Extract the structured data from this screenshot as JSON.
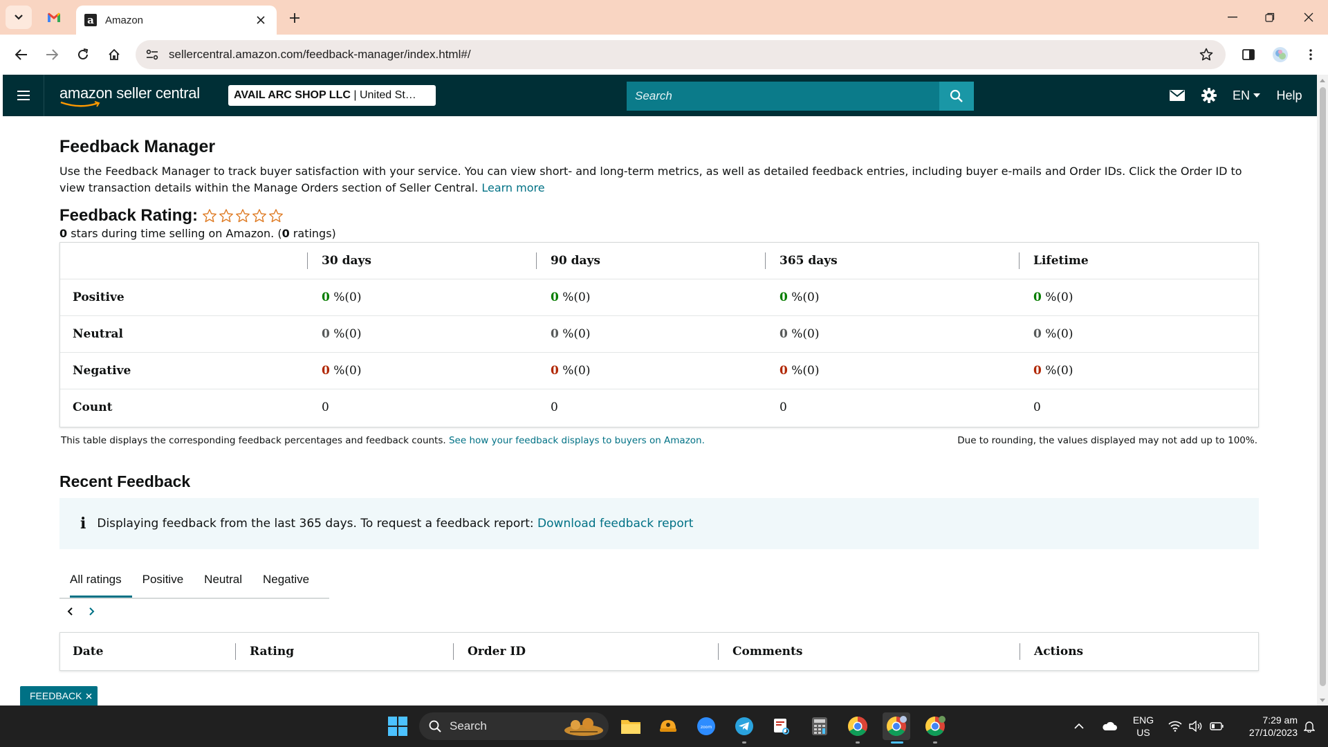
{
  "browser": {
    "tab_title": "Amazon",
    "url": "sellercentral.amazon.com/feedback-manager/index.html#/"
  },
  "header": {
    "logo": "amazon seller central",
    "account": "AVAIL ARC SHOP LLC",
    "account_suffix": " | United St…",
    "search_placeholder": "Search",
    "language": "EN",
    "help": "Help"
  },
  "page": {
    "title": "Feedback Manager",
    "intro": "Use the Feedback Manager to track buyer satisfaction with your service. You can view short- and long-term metrics, as well as detailed feedback entries, including buyer e-mails and Order IDs. Click the Order ID to view transaction details within the Manage Orders section of Seller Central.",
    "learn_more": "Learn more",
    "rating_label": "Feedback Rating:",
    "rating_stars": 0,
    "rating_value": "0",
    "rating_text_1": " stars during time selling on Amazon. (",
    "rating_count": "0",
    "rating_text_2": " ratings)"
  },
  "metrics": {
    "columns": [
      "30 days",
      "90 days",
      "365 days",
      "Lifetime"
    ],
    "rows": [
      {
        "label": "Positive",
        "cells": [
          [
            "0",
            " %(0)"
          ],
          [
            "0",
            " %(0)"
          ],
          [
            "0",
            " %(0)"
          ],
          [
            "0",
            " %(0)"
          ]
        ]
      },
      {
        "label": "Neutral",
        "cells": [
          [
            "0",
            " %(0)"
          ],
          [
            "0",
            " %(0)"
          ],
          [
            "0",
            " %(0)"
          ],
          [
            "0",
            " %(0)"
          ]
        ]
      },
      {
        "label": "Negative",
        "cells": [
          [
            "0",
            " %(0)"
          ],
          [
            "0",
            " %(0)"
          ],
          [
            "0",
            " %(0)"
          ],
          [
            "0",
            " %(0)"
          ]
        ]
      },
      {
        "label": "Count",
        "cells": [
          "0",
          "0",
          "0",
          "0"
        ]
      }
    ],
    "note": "This table displays the corresponding feedback percentages and feedback counts.",
    "note_link": "See how your feedback displays to buyers on Amazon.",
    "rounding_note": "Due to rounding, the values displayed may not add up to 100%."
  },
  "recent": {
    "title": "Recent Feedback",
    "info": "Displaying feedback from the last 365 days. To request a feedback report:",
    "info_link": "Download feedback report",
    "tabs": [
      "All ratings",
      "Positive",
      "Neutral",
      "Negative"
    ],
    "active_tab": "All ratings",
    "columns": [
      "Date",
      "Rating",
      "Order ID",
      "Comments",
      "Actions"
    ]
  },
  "feedback_button": "FEEDBACK",
  "taskbar": {
    "search": "Search",
    "lang_1": "ENG",
    "lang_2": "US",
    "time": "7:29 am",
    "date": "27/10/2023"
  },
  "colors": {
    "header_bg": "#002f36",
    "search_bg": "#0b7b8a",
    "link": "#007185",
    "positive": "#067d00",
    "negative": "#b12704"
  }
}
